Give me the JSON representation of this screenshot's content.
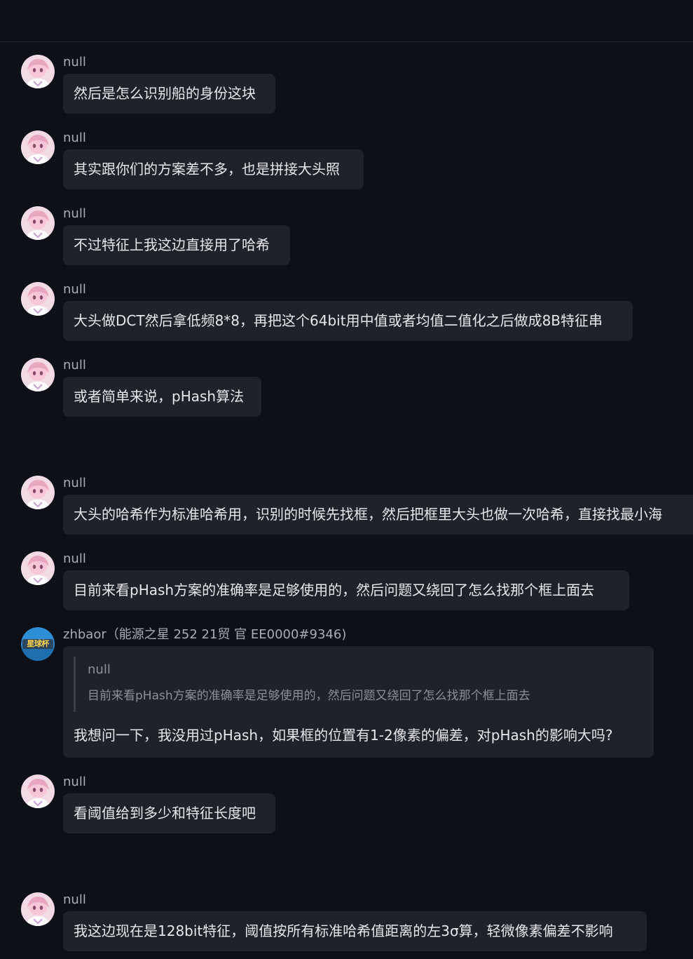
{
  "messages": [
    {
      "sender": "null",
      "text": "然后是怎么识别船的身份这块"
    },
    {
      "sender": "null",
      "text": "其实跟你们的方案差不多，也是拼接大头照"
    },
    {
      "sender": "null",
      "text": "不过特征上我这边直接用了哈希"
    },
    {
      "sender": "null",
      "text": "大头做DCT然后拿低频8*8，再把这个64bit用中值或者均值二值化之后做成8B特征串"
    },
    {
      "sender": "null",
      "text": "或者简单来说，pHash算法"
    },
    {
      "sender": "null",
      "text": "大头的哈希作为标准哈希用，识别的时候先找框，然后把框里大头也做一次哈希，直接找最小海"
    },
    {
      "sender": "null",
      "text": "目前来看pHash方案的准确率是足够使用的，然后问题又绕回了怎么找那个框上面去"
    },
    {
      "sender": "zhbaor（能源之星 252 21贸 官 EE0000#9346)",
      "avatar_text": "星球杯",
      "quote_sender": "null",
      "quote_text": "目前来看pHash方案的准确率是足够使用的，然后问题又绕回了怎么找那个框上面去",
      "text": "我想问一下，我没用过pHash，如果框的位置有1-2像素的偏差，对pHash的影响大吗?"
    },
    {
      "sender": "null",
      "text": "看阈值给到多少和特征长度吧"
    },
    {
      "sender": "null",
      "text": "我这边现在是128bit特征，阈值按所有标准哈希值距离的左3σ算，轻微像素偏差不影响"
    }
  ],
  "colors": {
    "background": "#0d1117",
    "bubble": "#1f2329",
    "text": "#e6e8eb",
    "sender": "#a8adb4",
    "quote": "#8b9097"
  }
}
